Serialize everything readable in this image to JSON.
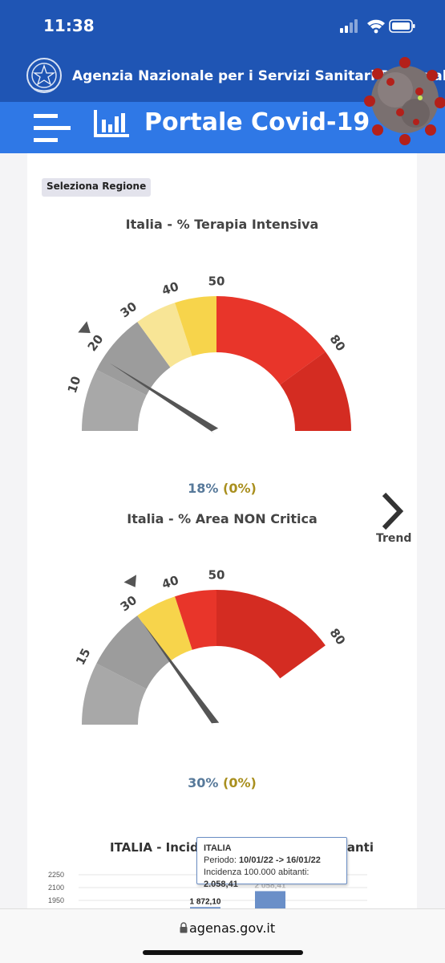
{
  "status_bar": {
    "time": "11:38"
  },
  "header": {
    "agency_name": "Agenzia Nazionale per i Servizi Sanitari Regionali",
    "portal_title": "Portale Covid-19"
  },
  "selector": {
    "label": "Seleziona Regione"
  },
  "gauges": [
    {
      "title": "Italia - % Terapia Intensiva",
      "value_text": "18%",
      "change_text": "(0%)",
      "value": 18,
      "marker": 21,
      "tick_labels": [
        "10",
        "20",
        "30",
        "40",
        "50",
        "80"
      ],
      "colors": [
        "#a8a8a8",
        "#9c9c9c",
        "#f8e596",
        "#f7d44b",
        "#e8352a",
        "#d42c22"
      ]
    },
    {
      "title": "Italia - % Area NON Critica",
      "value_text": "30%",
      "change_text": "(0%)",
      "value": 30,
      "marker": 33,
      "tick_labels": [
        "15",
        "30",
        "40",
        "50",
        "80"
      ],
      "colors": [
        "#a8a8a8",
        "#9c9c9c",
        "#f7d44b",
        "#e8352a",
        "#d42c22"
      ]
    }
  ],
  "trend": {
    "label": "Trend"
  },
  "incidence": {
    "title": "ITALIA - Incidenza per 100.000 abitanti",
    "chart_data": {
      "type": "bar",
      "y_ticks": [
        "2250",
        "2100",
        "1950"
      ],
      "values": [
        1872.1,
        2058.41
      ],
      "bar_labels": [
        "1 872,10",
        "2 058,41"
      ],
      "bar_color": "#6a8fc8"
    },
    "tooltip": {
      "header": "ITALIA",
      "periodo_label": "Periodo: ",
      "periodo_value": "10/01/22 -> 16/01/22",
      "incidenza_label": "Incidenza 100.000 abitanti: ",
      "incidenza_value": "2.058,41"
    }
  },
  "browser": {
    "address": "agenas.gov.it"
  }
}
